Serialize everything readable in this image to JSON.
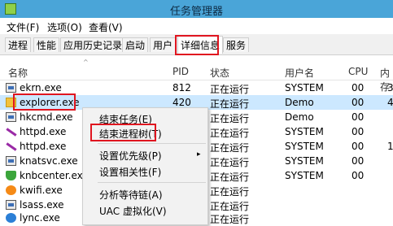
{
  "window": {
    "title": "任务管理器"
  },
  "menubar": {
    "items": [
      "文件(F)",
      "选项(O)",
      "查看(V)"
    ]
  },
  "tabs": [
    "进程",
    "性能",
    "应用历史记录",
    "启动",
    "用户",
    "详细信息",
    "服务"
  ],
  "columns": [
    "名称",
    "PID",
    "状态",
    "用户名",
    "CPU",
    "内存"
  ],
  "rows": [
    {
      "name": "ekrn.exe",
      "pid": "812",
      "status": "正在运行",
      "user": "SYSTEM",
      "cpu": "00",
      "mem": "3",
      "icon": "window-icon"
    },
    {
      "name": "explorer.exe",
      "pid": "420",
      "status": "正在运行",
      "user": "Demo",
      "cpu": "00",
      "mem": "4",
      "icon": "folder-icon"
    },
    {
      "name": "hkcmd.exe",
      "pid": "",
      "status": "正在运行",
      "user": "Demo",
      "cpu": "00",
      "mem": "",
      "icon": "window-icon"
    },
    {
      "name": "httpd.exe",
      "pid": "",
      "status": "正在运行",
      "user": "SYSTEM",
      "cpu": "00",
      "mem": "",
      "icon": "feather-icon"
    },
    {
      "name": "httpd.exe",
      "pid": "",
      "status": "正在运行",
      "user": "SYSTEM",
      "cpu": "00",
      "mem": "1",
      "icon": "feather-icon"
    },
    {
      "name": "knatsvc.exe",
      "pid": "",
      "status": "正在运行",
      "user": "SYSTEM",
      "cpu": "00",
      "mem": "",
      "icon": "window-icon"
    },
    {
      "name": "knbcenter.exe",
      "pid": "",
      "status": "正在运行",
      "user": "SYSTEM",
      "cpu": "00",
      "mem": "",
      "icon": "shield-icon"
    },
    {
      "name": "kwifi.exe",
      "pid": "",
      "status": "正在运行",
      "user": "",
      "cpu": "",
      "mem": "",
      "icon": "orange-icon"
    },
    {
      "name": "lsass.exe",
      "pid": "",
      "status": "正在运行",
      "user": "",
      "cpu": "",
      "mem": "",
      "icon": "window-icon"
    },
    {
      "name": "lync.exe",
      "pid": "",
      "status": "正在运行",
      "user": "",
      "cpu": "",
      "mem": "",
      "icon": "globe-icon"
    }
  ],
  "context_menu": {
    "items": [
      "结束任务(E)",
      "结束进程树(T)",
      "设置优先级(P)",
      "设置相关性(F)",
      "分析等待链(A)",
      "UAC 虚拟化(V)"
    ],
    "submenu_arrow": "▸"
  },
  "sort_arrow": "^"
}
